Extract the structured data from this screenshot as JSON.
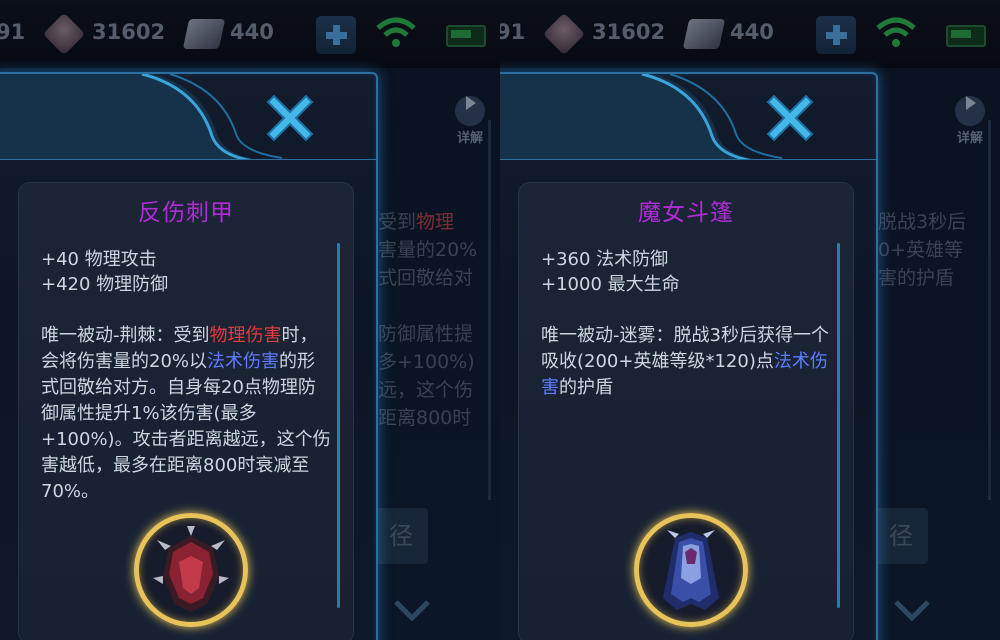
{
  "resources": {
    "partial": "91",
    "gems": "31602",
    "coupons": "440"
  },
  "background": {
    "detail_label": "详解",
    "lines_left": [
      {
        "prefix": "受到",
        "highlight": "物理"
      },
      {
        "prefix": "害量的20%",
        "highlight": ""
      },
      {
        "prefix": "式回敬给对",
        "highlight": ""
      },
      {
        "prefix": "",
        "highlight": ""
      },
      {
        "prefix": "防御属性提",
        "highlight": ""
      },
      {
        "prefix": "多+100%)",
        "highlight": ""
      },
      {
        "prefix": "远，这个伤",
        "highlight": ""
      },
      {
        "prefix": "距离800时",
        "highlight": ""
      }
    ],
    "lines_right": [
      "脱战3秒后",
      "0+英雄等",
      "害的护盾"
    ],
    "button_char": "径"
  },
  "items": [
    {
      "name": "反伤刺甲",
      "stats": [
        "+40 物理攻击",
        "+420 物理防御"
      ],
      "desc": [
        {
          "t": "唯一被动-荆棘：受到",
          "c": ""
        },
        {
          "t": "物理伤害",
          "c": "phys"
        },
        {
          "t": "时，会将伤害量的20%以",
          "c": ""
        },
        {
          "t": "法术伤害",
          "c": "mag"
        },
        {
          "t": "的形式回敬给对方。自身每20点物理防御属性提升1%该伤害(最多+100%)。攻击者距离越远，这个伤害越低，最多在距离800时衰减至70%。",
          "c": ""
        }
      ],
      "icon": "thornmail-armor-icon"
    },
    {
      "name": "魔女斗篷",
      "stats": [
        "+360 法术防御",
        "+1000 最大生命"
      ],
      "desc": [
        {
          "t": "唯一被动-迷雾：脱战3秒后获得一个吸收(200+英雄等级*120)点",
          "c": ""
        },
        {
          "t": "法术伤害",
          "c": "mag"
        },
        {
          "t": "的护盾",
          "c": ""
        }
      ],
      "icon": "witch-cloak-icon"
    }
  ],
  "colors": {
    "title": "#b12bd6",
    "physical": "#e23c3c",
    "magic": "#5e7cff",
    "frame": "#2a6f9e",
    "gold": "#e8c35a"
  }
}
